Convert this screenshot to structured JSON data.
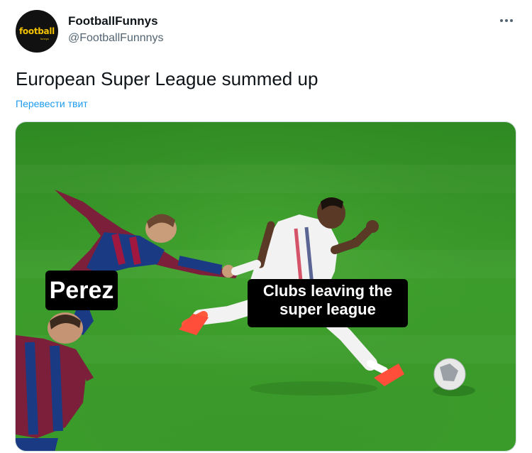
{
  "author": {
    "display_name": "FootballFunnys",
    "handle": "@FootballFunnnys",
    "avatar_text": "football",
    "avatar_subtext": "funnys"
  },
  "actions": {
    "more_icon": "more-horizontal-icon"
  },
  "tweet": {
    "text": "European Super League summed up",
    "translate_label": "Перевести твит"
  },
  "media": {
    "captions": {
      "left": "Perez",
      "right_line1": "Clubs leaving the",
      "right_line2": "super league"
    }
  },
  "colors": {
    "pitch": "#3c9a2a",
    "link": "#1d9bf0",
    "text": "#0f1419",
    "secondary": "#536471"
  }
}
